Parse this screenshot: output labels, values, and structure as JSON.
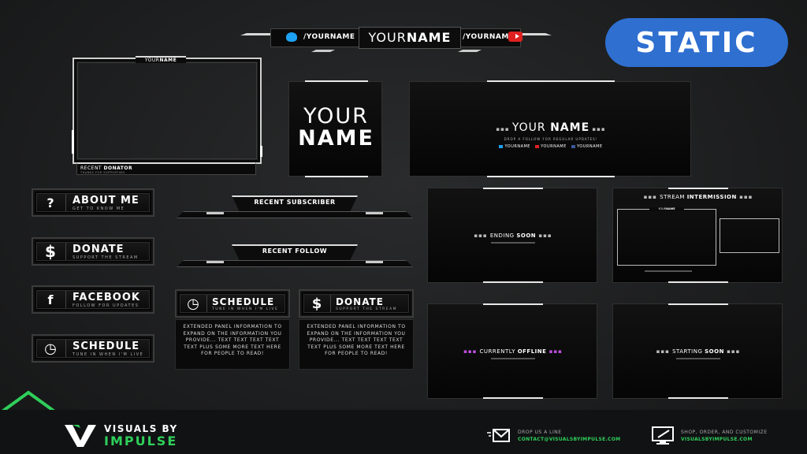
{
  "badge": {
    "label": "STATIC",
    "color": "#2e6fd0"
  },
  "accent_green": "#2fcf5a",
  "topbar": {
    "left_handle": "/YOURNAME",
    "center_name_light": "YOUR",
    "center_name_bold": "NAME",
    "right_handle": "/YOURNAME",
    "twitter_icon": "twitter-icon",
    "youtube_icon": "youtube-icon"
  },
  "webcam": {
    "tab_name_light": "YOUR",
    "tab_name_bold": "NAME",
    "recent_label_light": "RECENT",
    "recent_label_bold": "DONATOR",
    "recent_sub": "THANKS FOR SUPPORTING"
  },
  "name_card": {
    "line1": "YOUR",
    "line2": "NAME"
  },
  "banner_scene": {
    "name_light": "YOUR",
    "name_bold": "NAME",
    "tagline": "DROP A FOLLOW FOR REGULAR UPDATES!",
    "socials": [
      "YOURNAME",
      "YOURNAME",
      "YOURNAME"
    ]
  },
  "panels": [
    {
      "icon": "question-icon",
      "glyph": "?",
      "title": "ABOUT ME",
      "subtitle": "GET TO KNOW ME"
    },
    {
      "icon": "dollar-icon",
      "glyph": "$",
      "title": "DONATE",
      "subtitle": "SUPPORT THE STREAM"
    },
    {
      "icon": "facebook-icon",
      "glyph": "f",
      "title": "FACEBOOK",
      "subtitle": "FOLLOW FOR UPDATES"
    },
    {
      "icon": "clock-icon",
      "glyph": "◷",
      "title": "SCHEDULE",
      "subtitle": "TUNE IN WHEN I'M LIVE"
    }
  ],
  "alerts": [
    {
      "label": "RECENT SUBSCRIBER"
    },
    {
      "label": "RECENT FOLLOW"
    }
  ],
  "extended_panels": [
    {
      "icon": "clock-icon",
      "glyph": "◷",
      "title": "SCHEDULE",
      "subtitle": "TUNE IN WHEN I'M LIVE",
      "body": "EXTENDED PANEL INFORMATION TO EXPAND ON THE INFORMATION YOU PROVIDE... TEXT TEXT TEXT TEXT TEXT PLUS SOME MORE TEXT HERE FOR PEOPLE TO READ!"
    },
    {
      "icon": "dollar-icon",
      "glyph": "$",
      "title": "DONATE",
      "subtitle": "SUPPORT THE STREAM",
      "body": "EXTENDED PANEL INFORMATION TO EXPAND ON THE INFORMATION YOU PROVIDE... TEXT TEXT TEXT TEXT TEXT PLUS SOME MORE TEXT HERE FOR PEOPLE TO READ!"
    }
  ],
  "scenes": {
    "ending": {
      "light": "ENDING",
      "bold": "SOON"
    },
    "intermission": {
      "light": "STREAM",
      "bold": "INTERMISSION",
      "cam_light": "YOUR",
      "cam_bold": "NAME"
    },
    "offline": {
      "light": "CURRENTLY",
      "bold": "OFFLINE"
    },
    "starting": {
      "light": "STARTING",
      "bold": "SOON"
    }
  },
  "footer": {
    "brand_line1": "VISUALS BY",
    "brand_line2": "IMPULSE",
    "contact_label": "DROP US A LINE",
    "contact_value": "CONTACT@VISUALSBYIMPULSE.COM",
    "shop_label": "SHOP, ORDER, AND CUSTOMIZE",
    "shop_value": "VISUALSBYIMPULSE.COM"
  }
}
